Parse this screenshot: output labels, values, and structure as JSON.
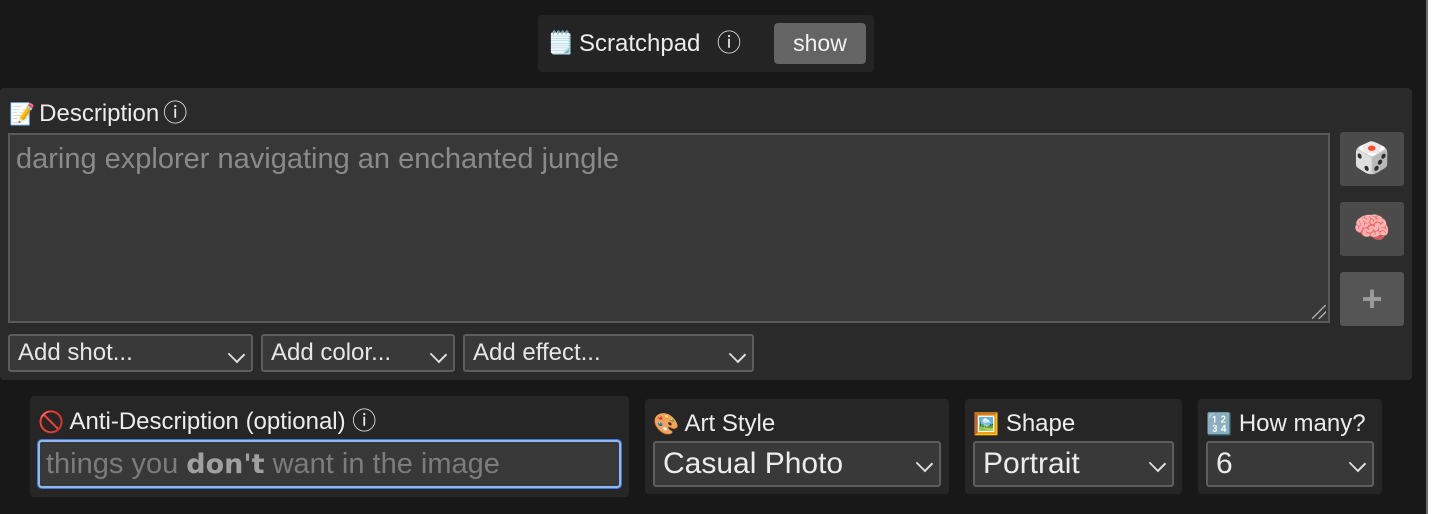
{
  "scratchpad": {
    "icon": "notepad-icon",
    "icon_glyph": "🗒️",
    "label": "Scratchpad",
    "info_glyph": "ⓘ",
    "button_label": "show"
  },
  "description": {
    "icon": "memo-icon",
    "icon_glyph": "📝",
    "label": "Description",
    "info_glyph": "ⓘ",
    "placeholder": "daring explorer navigating an enchanted jungle",
    "side_buttons": [
      {
        "name": "dice-icon",
        "glyph": "🎲"
      },
      {
        "name": "brain-icon",
        "glyph": "🧠"
      },
      {
        "name": "plus-icon",
        "glyph": "+"
      }
    ],
    "selects": [
      {
        "value": "Add shot..."
      },
      {
        "value": "Add color..."
      },
      {
        "value": "Add effect..."
      }
    ]
  },
  "anti_description": {
    "icon": "prohibited-icon",
    "icon_glyph": "🚫",
    "label": "Anti-Description (optional)",
    "info_glyph": "ⓘ",
    "placeholder_before": "things you ",
    "placeholder_bold": "don't",
    "placeholder_after": " want in the image"
  },
  "art_style": {
    "icon": "palette-icon",
    "icon_glyph": "🎨",
    "label": "Art Style",
    "value": "Casual Photo"
  },
  "shape": {
    "icon": "framed-picture-icon",
    "icon_glyph": "🖼️",
    "label": "Shape",
    "value": "Portrait"
  },
  "how_many": {
    "icon": "numbers-icon",
    "icon_glyph": "🔢",
    "label": "How many?",
    "value": "6"
  },
  "colors": {
    "focus_border": "#8fb7f2",
    "panel": "#2a2a2a",
    "background": "#181818"
  }
}
